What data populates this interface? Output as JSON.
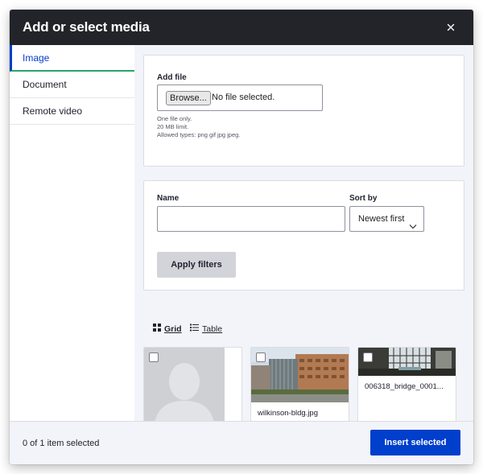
{
  "dialog": {
    "title": "Add or select media",
    "close_icon": "close-icon"
  },
  "sidebar": {
    "tabs": [
      {
        "label": "Image",
        "active": true
      },
      {
        "label": "Document",
        "active": false
      },
      {
        "label": "Remote video",
        "active": false
      }
    ]
  },
  "upload": {
    "label": "Add file",
    "browse_label": "Browse...",
    "no_file_text": "No file selected.",
    "help_lines": [
      "One file only.",
      "20 MB limit.",
      "Allowed types: png gif jpg jpeg."
    ]
  },
  "filters": {
    "name_label": "Name",
    "name_value": "",
    "sort_label": "Sort by",
    "sort_value": "Newest first",
    "apply_label": "Apply filters"
  },
  "views": {
    "grid_label": "Grid",
    "table_label": "Table",
    "active": "grid"
  },
  "media_items": [
    {
      "filename": "",
      "checked": false,
      "thumb": "person-placeholder"
    },
    {
      "filename": "wilkinson-bldg.jpg",
      "checked": false,
      "thumb": "building-photo"
    },
    {
      "filename": "006318_bridge_0001...",
      "checked": false,
      "thumb": "bridge-photo"
    }
  ],
  "footer": {
    "selection_text": "0 of 1 item selected",
    "insert_label": "Insert selected"
  },
  "colors": {
    "titlebar": "#232429",
    "accent_blue": "#003ecc",
    "tab_underline_green": "#26a769",
    "panel_bg": "#f3f4f9",
    "button_gray": "#d3d4d9"
  }
}
